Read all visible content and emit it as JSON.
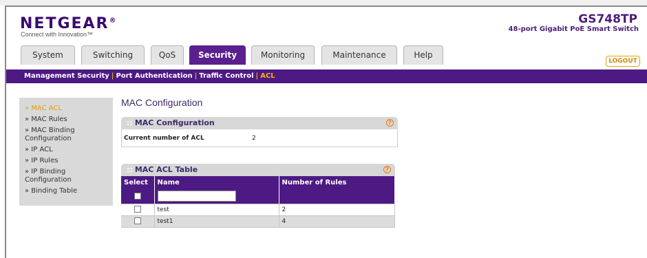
{
  "header": {
    "brand": "NETGEAR",
    "brand_mark": "®",
    "tagline": "Connect with Innovation™",
    "model": "GS748TP",
    "model_desc": "48-port Gigabit PoE Smart Switch",
    "logout_label": "LOGOUT"
  },
  "tabs": [
    {
      "label": "System"
    },
    {
      "label": "Switching"
    },
    {
      "label": "QoS"
    },
    {
      "label": "Security",
      "active": true
    },
    {
      "label": "Monitoring"
    },
    {
      "label": "Maintenance"
    },
    {
      "label": "Help"
    }
  ],
  "subnav": {
    "items": [
      "Management Security",
      "Port Authentication",
      "Traffic Control",
      "ACL"
    ],
    "current": "ACL",
    "separator": "|"
  },
  "sidebar": {
    "items": [
      {
        "label": "» MAC ACL",
        "active": true
      },
      {
        "label": "» MAC Rules"
      },
      {
        "label": "» MAC Binding Configuration"
      },
      {
        "label": "» IP ACL"
      },
      {
        "label": "» IP Rules"
      },
      {
        "label": "» IP Binding Configuration"
      },
      {
        "label": "» Binding Table"
      }
    ]
  },
  "main": {
    "title": "MAC Configuration",
    "config_panel": {
      "title": "MAC Configuration",
      "dots": "::",
      "help": "?",
      "field_label": "Current number of ACL",
      "field_value": "2"
    },
    "table_panel": {
      "title": "MAC ACL Table",
      "dots": "::",
      "help": "?",
      "columns": [
        "Select",
        "Name",
        "Number of Rules"
      ],
      "name_input_value": "",
      "rows": [
        {
          "name": "test",
          "rules": "2"
        },
        {
          "name": "test1",
          "rules": "4"
        }
      ]
    }
  },
  "colors": {
    "brand_purple": "#4d1a84",
    "accent_orange": "#f5b400"
  }
}
